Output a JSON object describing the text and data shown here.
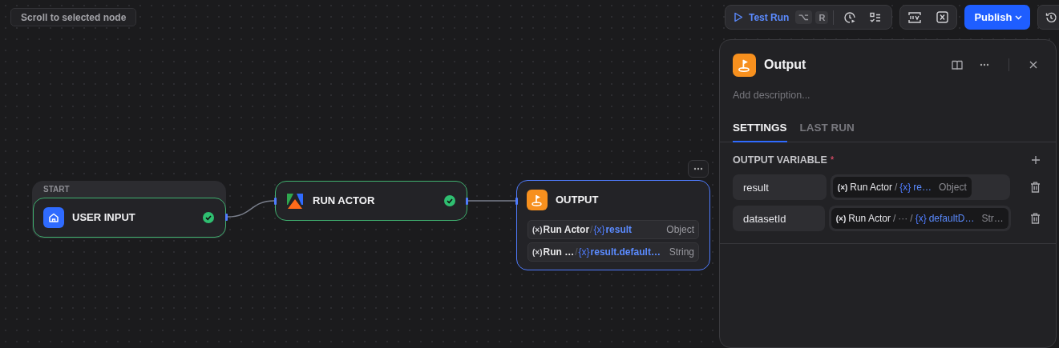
{
  "canvas": {
    "scroll_button": "Scroll to selected node",
    "nodes": [
      {
        "kind": "start",
        "group_label": "START",
        "title": "USER INPUT",
        "done": true,
        "selected": false
      },
      {
        "kind": "actor",
        "title": "RUN ACTOR",
        "done": true,
        "selected": false
      },
      {
        "kind": "output",
        "title": "OUTPUT",
        "selected": true,
        "vars": [
          {
            "prefix": "(×)",
            "source": "Run Actor",
            "separator": "/",
            "var_mark": "{x}",
            "name": "result",
            "type": "Object"
          },
          {
            "prefix": "(×)",
            "source": "Run …",
            "separator": "/",
            "var_mark": "{x}",
            "name": "result.default…",
            "type": "String"
          }
        ]
      }
    ]
  },
  "toolbar": {
    "test_run": "Test Run",
    "shortcut_keys": [
      "⌥",
      "R"
    ],
    "publish": "Publish"
  },
  "panel": {
    "title": "Output",
    "description_placeholder": "Add description...",
    "tabs": [
      {
        "label": "SETTINGS",
        "selected": true
      },
      {
        "label": "LAST RUN",
        "selected": false
      }
    ],
    "section_title": "OUTPUT VARIABLE",
    "required_mark": "*",
    "variables": [
      {
        "name": "result",
        "ref": {
          "prefix": "(×)",
          "source": "Run Actor",
          "separator": "/",
          "var_mark": "{x}",
          "var": "re…",
          "type": "Object"
        }
      },
      {
        "name": "datasetId",
        "ref": {
          "prefix": "(×)",
          "source": "Run Actor",
          "separator": "/",
          "middle": "···",
          "separator2": "/",
          "var_mark": "{x}",
          "var": "defaultD…",
          "type": "Str…"
        }
      }
    ]
  }
}
